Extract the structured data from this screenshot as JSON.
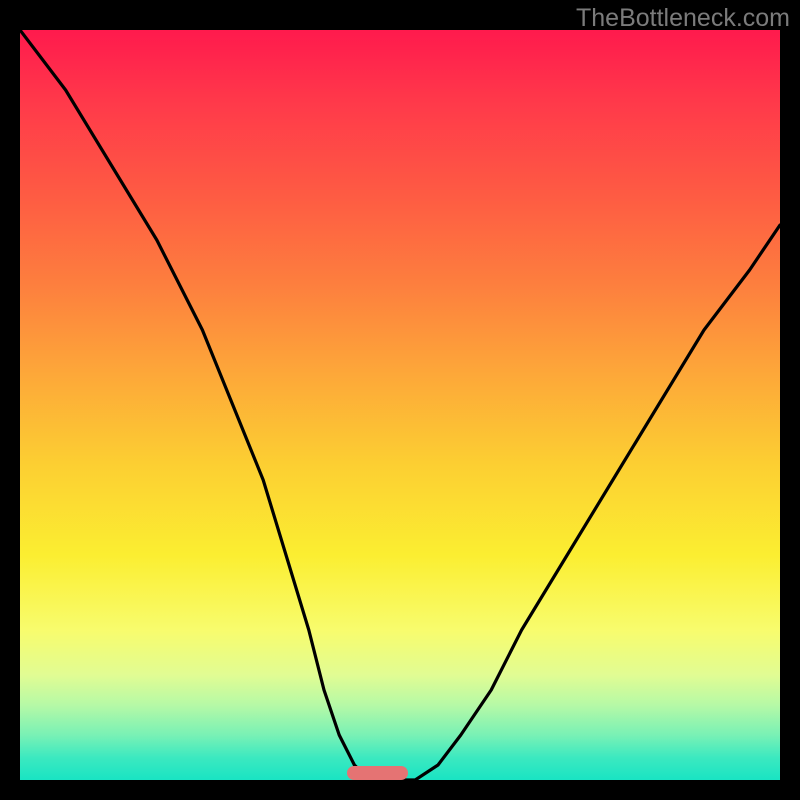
{
  "watermark": "TheBottleneck.com",
  "chart_data": {
    "type": "line",
    "title": "",
    "xlabel": "",
    "ylabel": "",
    "xlim": [
      0,
      100
    ],
    "ylim": [
      0,
      100
    ],
    "x": [
      0,
      6,
      12,
      18,
      24,
      28,
      32,
      35,
      38,
      40,
      42,
      44,
      46,
      48,
      50,
      52,
      55,
      58,
      62,
      66,
      72,
      78,
      84,
      90,
      96,
      100
    ],
    "y": [
      100,
      92,
      82,
      72,
      60,
      50,
      40,
      30,
      20,
      12,
      6,
      2,
      0,
      0,
      0,
      0,
      2,
      6,
      12,
      20,
      30,
      40,
      50,
      60,
      68,
      74
    ],
    "series": [
      {
        "name": "bottleneck-curve",
        "x_ref": "x",
        "y_ref": "y"
      }
    ],
    "background_gradient_stops": [
      {
        "pos": 0,
        "color": "#ff1a4d"
      },
      {
        "pos": 22,
        "color": "#fe5b43"
      },
      {
        "pos": 46,
        "color": "#fda839"
      },
      {
        "pos": 70,
        "color": "#fbee31"
      },
      {
        "pos": 90,
        "color": "#b6f9a6"
      },
      {
        "pos": 100,
        "color": "#19e4c3"
      }
    ],
    "marker": {
      "x_center": 47,
      "width": 8,
      "color": "#e57373"
    }
  },
  "colors": {
    "curve_stroke": "#000000",
    "watermark": "#7b7b7b",
    "plot_border": "#000000"
  }
}
